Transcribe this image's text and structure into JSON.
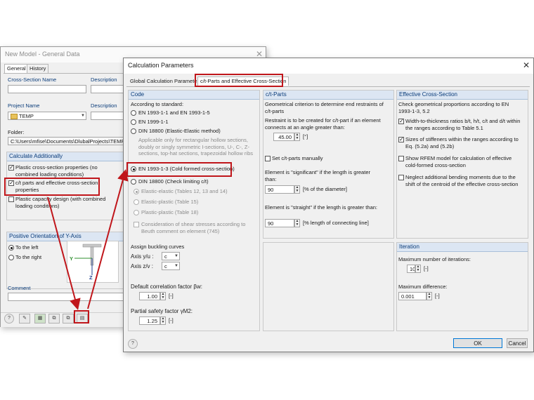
{
  "back_window": {
    "title": "New Model - General Data",
    "tabs": [
      "General",
      "History"
    ],
    "cross_section_name_label": "Cross-Section Name",
    "description_label": "Description",
    "project_name_label": "Project Name",
    "description_label_2": "Description",
    "project_value": "TEMP",
    "folder_label": "Folder:",
    "folder_value": "C:\\Users\\mfise\\Documents\\DlubalProjects\\TEMP",
    "calc_additionally_header": "Calculate Additionally",
    "options": [
      {
        "label": "Plastic cross-section properties (no combined loading conditions)",
        "checked": true
      },
      {
        "label": "c/t parts and effective cross-section properties",
        "checked": true
      },
      {
        "label": "Plastic capacity design (with combined loading conditions)",
        "checked": false
      }
    ],
    "orientation_header": "Positive Orientation of Y-Axis",
    "orientation_left": "To the left",
    "orientation_right": "To the right",
    "axis_y": "Y",
    "axis_z": "Z",
    "comment_label": "Comment"
  },
  "dialog": {
    "title": "Calculation Parameters",
    "tabs": [
      "Global Calculation Parameters",
      "c/t-Parts and Effective Cross-Section"
    ],
    "code": {
      "header": "Code",
      "according_label": "According to standard:",
      "standards": [
        "EN 1993-1-1 and EN 1993-1-5",
        "EN 1999-1-1",
        "DIN 18800 (Elastic-Elastic method)"
      ],
      "din_note": "Applicable only for rectangular hollow sections, doubly or singly symmetric I-sections, U-, C-, Z-sections, top-hat sections, trapezoidal hollow ribs",
      "cold_formed": "EN 1993-1-3 (Cold formed cross-section)",
      "din_ct": "DIN 18800 (Check limiting c/t)",
      "sub_methods": [
        "Elastic-elastic (Tables 12, 13 and 14)",
        "Elastic-plastic (Table 15)",
        "Plastic-plastic (Table 18)"
      ],
      "shear_note": "Consideration of shear stresses according to Beuth comment on element (745)",
      "buckling_label": "Assign buckling curves",
      "axis_yu_label": "Axis y/u :",
      "axis_yu_value": "c",
      "axis_zv_label": "Axis z/v :",
      "axis_zv_value": "c",
      "correlation_label": "Default correlation factor βw:",
      "correlation_value": "1.00",
      "correlation_unit": "[-]",
      "safety_label": "Partial safety factor γM2:",
      "safety_value": "1.25",
      "safety_unit": "[-]"
    },
    "ct_parts": {
      "header": "c/t-Parts",
      "geom_desc": "Geometrical criterion to determine end restraints of c/t-parts",
      "restraint_label": "Restraint is to be created for c/t-part if an element connects at an angle greater than:",
      "angle_value": "45.00",
      "angle_unit": "[°]",
      "set_manually": "Set c/t-parts manually",
      "significant_label": "Element is \"significant\" if the length is greater than:",
      "significant_value": "90",
      "significant_unit": "[% of the diameter]",
      "straight_label": "Element is \"straight\" if the length is greater than:",
      "straight_value": "90",
      "straight_unit": "[% length of connecting line]"
    },
    "effective": {
      "header": "Effective Cross-Section",
      "check_desc": "Check geometrical proportions according to EN 1993-1-3, 5.2",
      "options": [
        {
          "label": "Width-to-thickness ratios b/t, h/t, c/t and d/t within the ranges according to Table 5.1",
          "checked": true
        },
        {
          "label": "Sizes of stiffeners within the ranges according to Eq. (5.2a) and (5.2b)",
          "checked": true
        },
        {
          "label": "Show RFEM model for calculation of effective cold-formed cross-section",
          "checked": false
        },
        {
          "label": "Neglect additional bending moments due to the shift of the centroid of the effective cross-section",
          "checked": false
        }
      ]
    },
    "iteration": {
      "header": "Iteration",
      "max_label": "Maximum number of iterations:",
      "max_value": "10",
      "max_unit": "[-]",
      "diff_label": "Maximum difference:",
      "diff_value": "0.001",
      "diff_unit": "[-]"
    },
    "ok_label": "OK",
    "cancel_label": "Cancel"
  },
  "colors": {
    "highlight": "#c0161b",
    "panel_header_bg": "#dce6f3",
    "panel_header_text": "#0a3c7a"
  }
}
